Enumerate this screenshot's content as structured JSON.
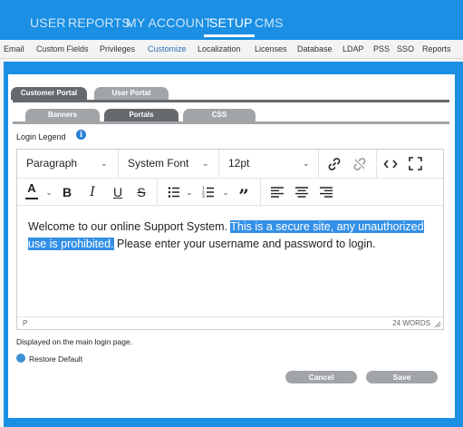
{
  "topnav": {
    "items": [
      {
        "label": "USER"
      },
      {
        "label": "REPORTS"
      },
      {
        "label": "MY ACCOUNT"
      },
      {
        "label": "SETUP",
        "active": true
      },
      {
        "label": "CMS"
      }
    ]
  },
  "subnav": {
    "items": [
      {
        "label": "Email"
      },
      {
        "label": "Custom Fields"
      },
      {
        "label": "Privileges"
      },
      {
        "label": "Customize",
        "active": true
      },
      {
        "label": "Localization"
      },
      {
        "label": "Licenses"
      },
      {
        "label": "Database"
      },
      {
        "label": "LDAP"
      },
      {
        "label": "PSS"
      },
      {
        "label": "SSO"
      },
      {
        "label": "Reports"
      }
    ]
  },
  "tabs": {
    "primary": [
      {
        "label": "Customer Portal",
        "active": true
      },
      {
        "label": "User Portal"
      }
    ],
    "secondary": [
      {
        "label": "Banners"
      },
      {
        "label": "Portals",
        "active": true
      },
      {
        "label": "CSS"
      }
    ]
  },
  "field": {
    "label": "Login Legend",
    "info_icon": "info-icon"
  },
  "editor": {
    "block_format": "Paragraph",
    "font_family": "System Font",
    "font_size": "12pt",
    "content_plain_start": "Welcome to our online Support System. ",
    "content_highlight": "This is a secure site, any unauthorized use is prohibited.",
    "content_plain_end": "  Please enter your username and password to login.",
    "status_path": "P",
    "word_count": "24 WORDS",
    "icons": [
      "text-color-icon",
      "bold-icon",
      "italic-icon",
      "underline-icon",
      "strikethrough-icon",
      "bullet-list-icon",
      "numbered-list-icon",
      "blockquote-icon",
      "align-left-icon",
      "align-center-icon",
      "align-right-icon",
      "link-icon",
      "unlink-icon",
      "source-code-icon",
      "fullscreen-icon"
    ]
  },
  "help_text": "Displayed on the main login page.",
  "restore_label": "Restore Default",
  "buttons": {
    "cancel": "Cancel",
    "save": "Save"
  },
  "colors": {
    "brand_blue": "#1a8fe3",
    "tab_dark": "#666a6e",
    "tab_light": "#a2a5a8",
    "selection": "#3390e6"
  }
}
